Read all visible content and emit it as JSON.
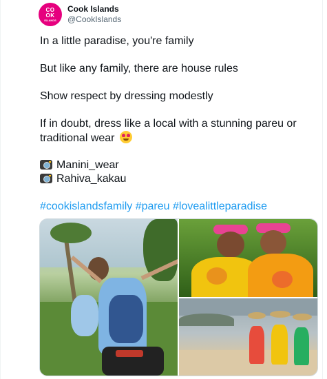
{
  "account": {
    "name": "Cook Islands",
    "handle": "@CookIslands",
    "logo": {
      "line1": "CO",
      "line2": "OK",
      "line3": "ISLANDS",
      "color": "#e6007e"
    }
  },
  "tweet": {
    "line1": "In a little paradise, you're family",
    "line2": "But like any family, there are house rules",
    "line3": "Show respect by dressing modestly",
    "line4a": "If in doubt, dress like a local with a stunning pareu or",
    "line4b": "traditional wear",
    "emoji": "heart-eyes-emoji",
    "credit1": "Manini_wear",
    "credit2": "Rahiva_kakau",
    "hashtags": "#cookislandsfamily #pareu #lovealittleparadise"
  },
  "media": {
    "photo1": "woman-on-scooter-photo",
    "photo2": "women-in-yellow-with-flower-crowns-photo",
    "photo3": "women-on-beach-photo"
  }
}
